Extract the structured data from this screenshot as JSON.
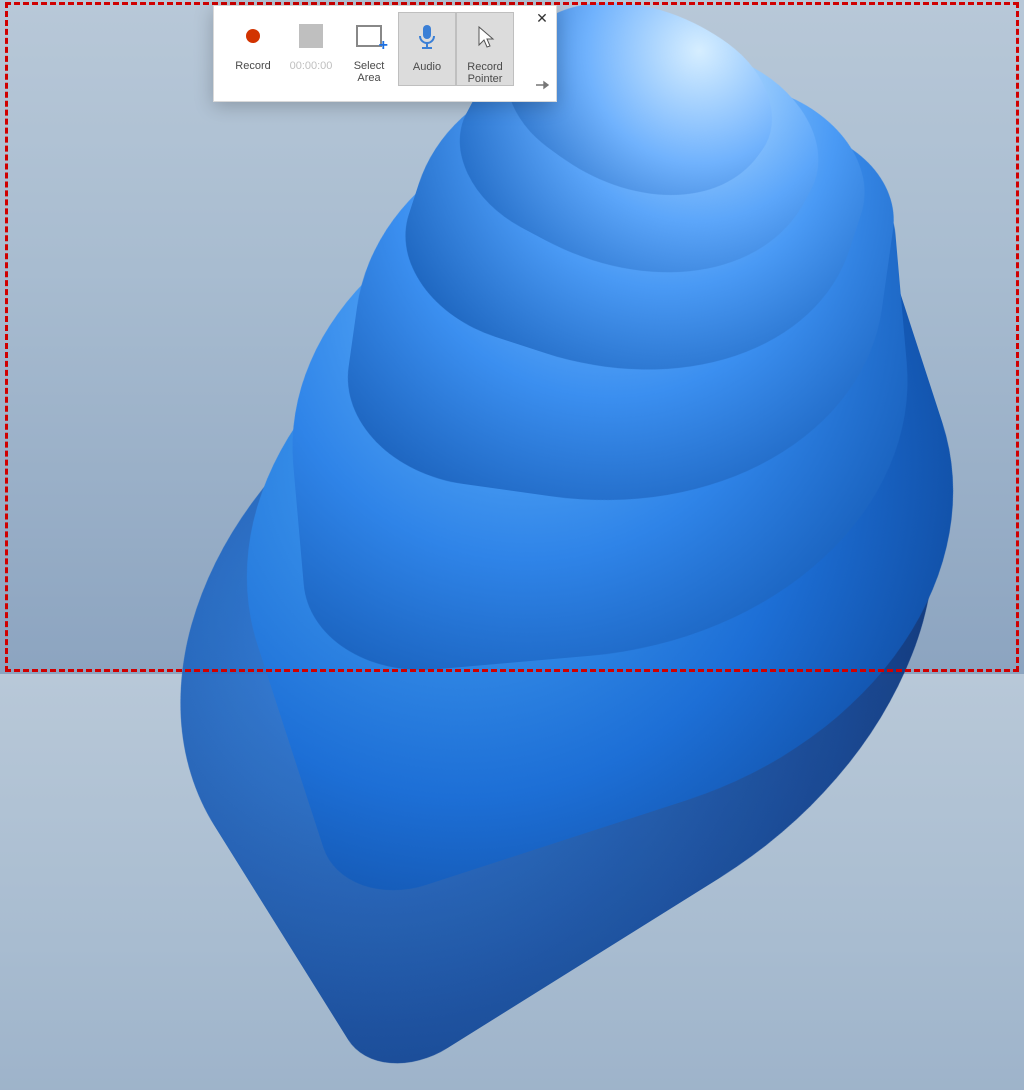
{
  "toolbar": {
    "record_label": "Record",
    "timer_value": "00:00:00",
    "select_area_label": "Select\nArea",
    "audio_label": "Audio",
    "record_pointer_label": "Record\nPointer"
  },
  "selection": {
    "border_color": "#d00000"
  }
}
